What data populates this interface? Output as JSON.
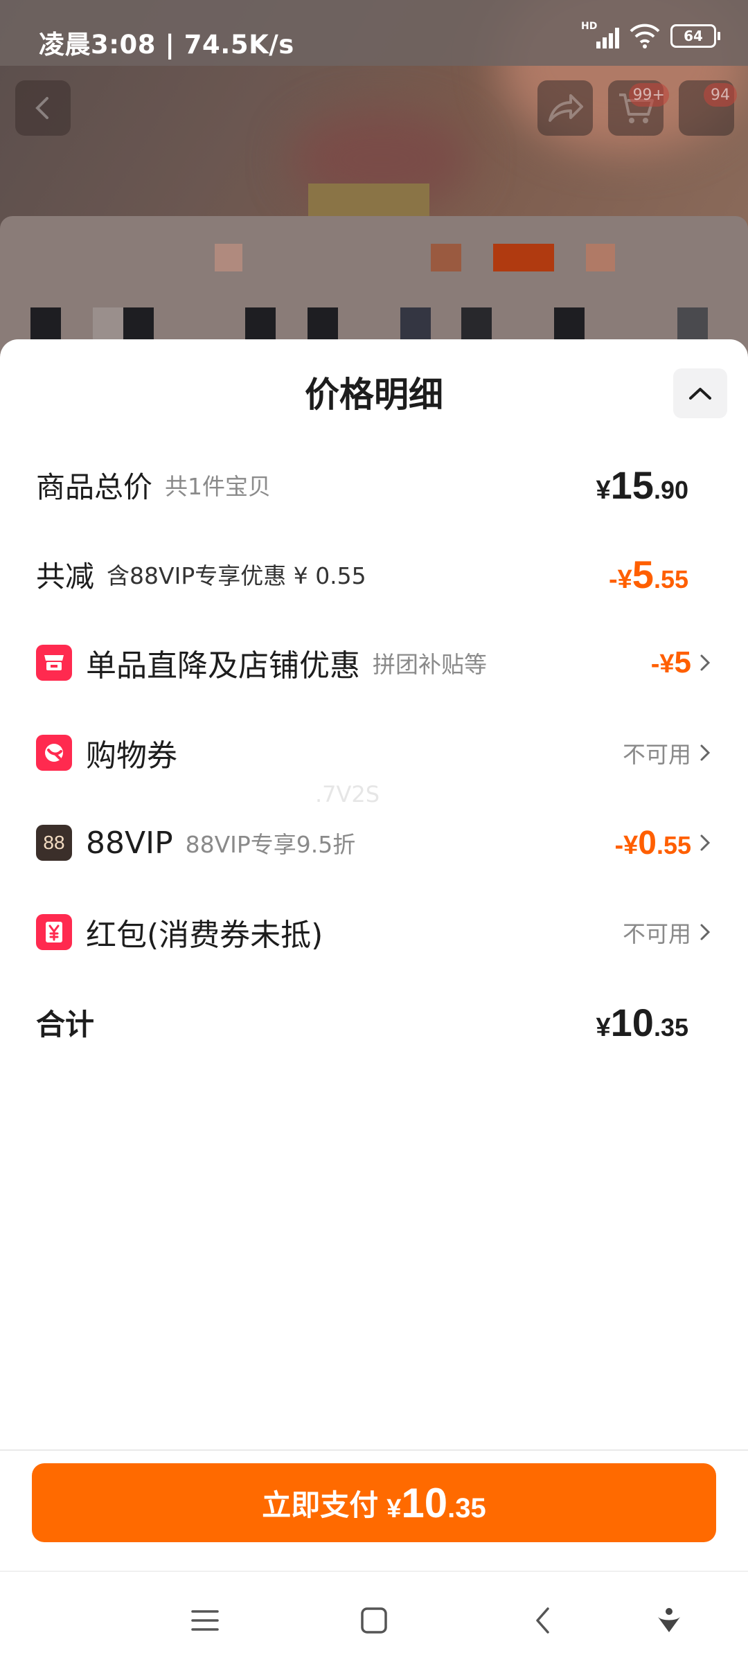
{
  "status_bar": {
    "time_speed": "凌晨3:08 | 74.5K/s",
    "network": "HD",
    "battery": "64"
  },
  "background": {
    "cart_badge": "99+",
    "more_badge": "94",
    "colors": {
      "overlay": "#6d5f5a"
    }
  },
  "sheet": {
    "title": "价格明细",
    "rows": {
      "total": {
        "label": "商品总价",
        "sub": "共1件宝贝",
        "price": {
          "cur": "¥",
          "int": "15",
          "dec": ".90"
        }
      },
      "reduce": {
        "label": "共减",
        "sub": "含88VIP专享优惠 ¥ 0.55",
        "price": {
          "cur": "-¥",
          "int": "5",
          "dec": ".55"
        }
      },
      "item_discount": {
        "label": "单品直降及店铺优惠",
        "sub": "拼团补贴等",
        "price": {
          "cur": "-¥",
          "int": "5",
          "dec": ""
        },
        "icon": "shop-icon"
      },
      "coupon": {
        "label": "购物券",
        "status": "不可用",
        "icon": "coupon-icon"
      },
      "vip": {
        "label": "88VIP",
        "sub": "88VIP专享9.5折",
        "price": {
          "cur": "-¥",
          "int": "0",
          "dec": ".55"
        },
        "icon_text": "88"
      },
      "red_packet": {
        "label": "红包(消费券未抵)",
        "status": "不可用",
        "icon": "yen-icon"
      },
      "sum": {
        "label": "合计",
        "price": {
          "cur": "¥",
          "int": "10",
          "dec": ".35"
        }
      }
    },
    "watermark": ".7V2S"
  },
  "footer": {
    "pay_label": "立即支付",
    "pay_price": {
      "cur": "¥",
      "int": "10",
      "dec": ".35"
    }
  },
  "colors": {
    "accent": "#ff6a00",
    "discount_text": "#ff5f00",
    "icon_red": "#ff2a4f",
    "vip_dark": "#3b2f2a"
  }
}
